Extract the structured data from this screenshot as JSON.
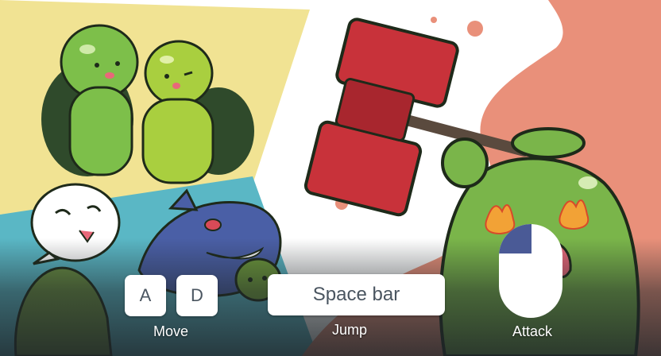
{
  "controls": {
    "key_a": "A",
    "key_d": "D",
    "space_key": "Space bar",
    "move_label": "Move",
    "jump_label": "Jump",
    "attack_label": "Attack"
  },
  "colors": {
    "yellow_panel": "#f1e393",
    "teal_panel": "#5ab7c5",
    "salmon_panel": "#e9907a",
    "turtle_green": "#7dbf4a",
    "hammer_red": "#c8323a",
    "shark_blue": "#4a5fa6"
  },
  "icons": [
    "mouse-left-click-icon"
  ]
}
